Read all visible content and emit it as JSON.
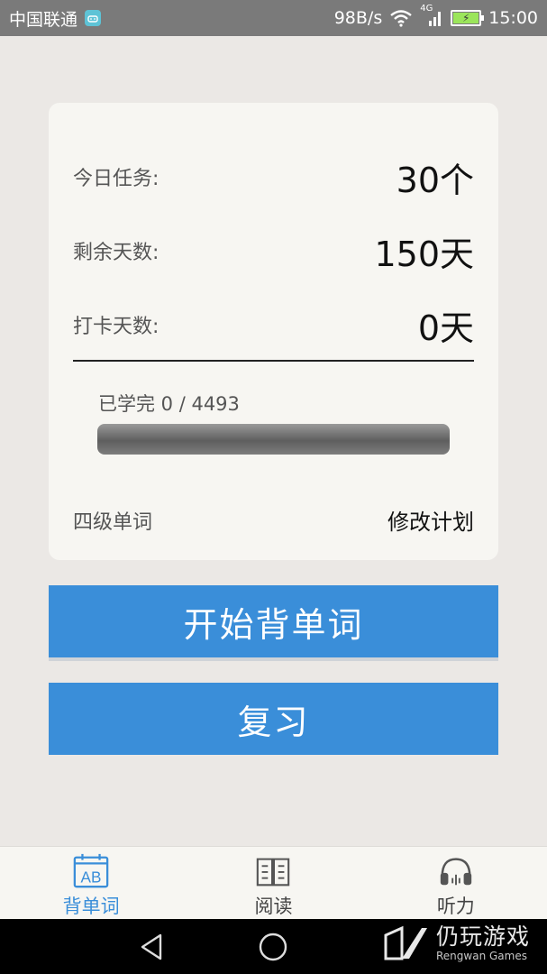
{
  "status_bar": {
    "carrier": "中国联通",
    "speed": "98B/s",
    "network": "4G",
    "time": "15:00"
  },
  "stats": [
    {
      "label": "今日任务:",
      "value": "30个"
    },
    {
      "label": "剩余天数:",
      "value": "150天"
    },
    {
      "label": "打卡天数:",
      "value": "0天"
    }
  ],
  "progress": {
    "label": "已学完 0 / 4493",
    "learned": 0,
    "total": 4493
  },
  "card_footer": {
    "book_name": "四级单词",
    "edit_plan": "修改计划"
  },
  "buttons": {
    "start": "开始背单词",
    "review": "复习"
  },
  "tabs": [
    {
      "label": "背单词",
      "icon": "calendar-ab-icon",
      "active": true
    },
    {
      "label": "阅读",
      "icon": "book-icon",
      "active": false
    },
    {
      "label": "听力",
      "icon": "headphones-icon",
      "active": false
    }
  ],
  "watermark": {
    "cn": "仍玩游戏",
    "en": "Rengwan Games"
  },
  "colors": {
    "accent": "#3a8ed9",
    "background": "#ebe8e5",
    "card": "#f7f6f2"
  }
}
